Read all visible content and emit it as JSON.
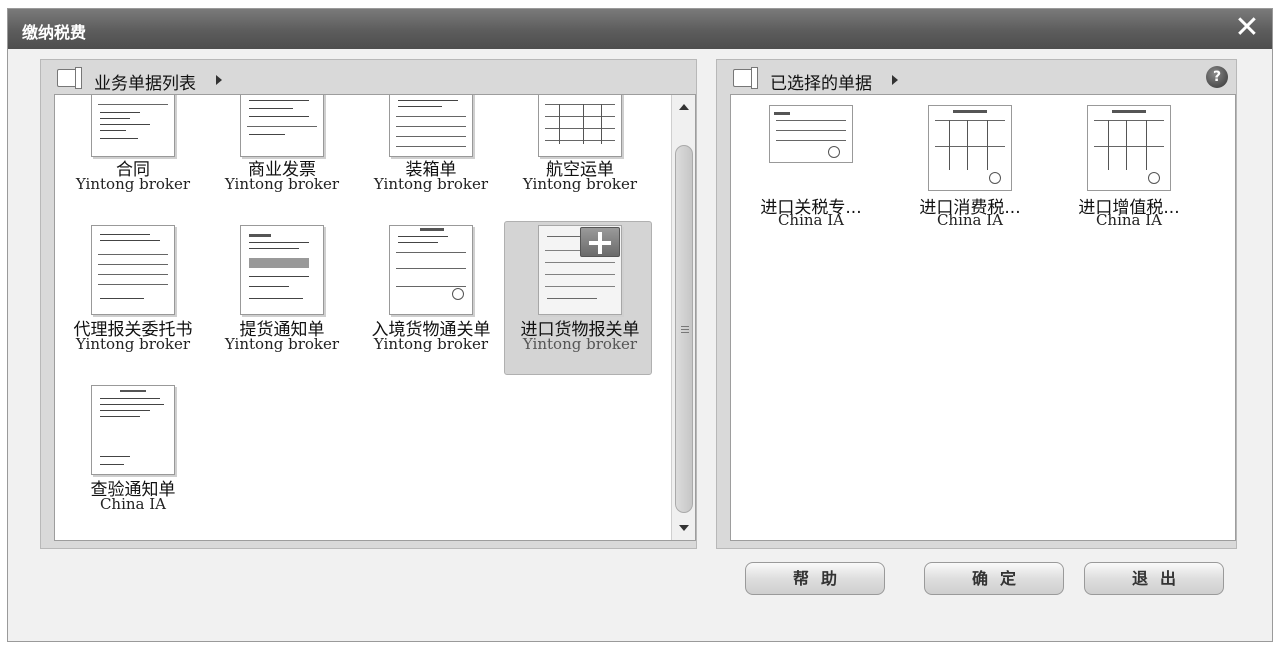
{
  "window": {
    "title": "缴纳税费",
    "close_glyph": "✕"
  },
  "left_panel": {
    "title": "业务单据列表",
    "documents": [
      {
        "name": "合同",
        "owner": "Yintong broker"
      },
      {
        "name": "商业发票",
        "owner": "Yintong broker"
      },
      {
        "name": "装箱单",
        "owner": "Yintong broker"
      },
      {
        "name": "航空运单",
        "owner": "Yintong broker"
      },
      {
        "name": "代理报关委托书",
        "owner": "Yintong broker"
      },
      {
        "name": "提货通知单",
        "owner": "Yintong broker"
      },
      {
        "name": "入境货物通关单",
        "owner": "Yintong broker"
      },
      {
        "name": "进口货物报关单",
        "owner": "Yintong broker"
      },
      {
        "name": "查验通知单",
        "owner": "China IA"
      }
    ],
    "selected_index": 7
  },
  "right_panel": {
    "title": "已选择的单据",
    "help_glyph": "?",
    "documents": [
      {
        "name": "进口关税专...",
        "owner": "China IA"
      },
      {
        "name": "进口消费税...",
        "owner": "China IA"
      },
      {
        "name": "进口增值税...",
        "owner": "China IA"
      }
    ]
  },
  "buttons": {
    "help": "帮助",
    "confirm": "确定",
    "exit": "退出"
  },
  "colors": {
    "titlebar": "#5c5c5c",
    "panel": "#d9d9d9",
    "background": "#f1f1f1"
  },
  "icons": [
    "book-icon",
    "triangle-right-icon",
    "help-icon",
    "close-icon",
    "add-icon",
    "scroll-up-icon",
    "scroll-down-icon"
  ]
}
